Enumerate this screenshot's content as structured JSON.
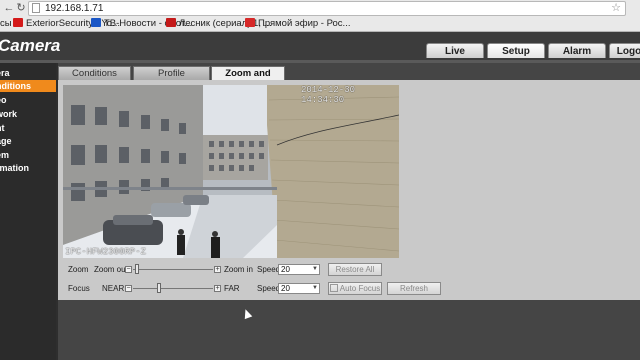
{
  "browser": {
    "url": "192.168.1.71",
    "bookmarks": [
      {
        "label": "сы",
        "color": "#cc5500"
      },
      {
        "label": "ExteriorSecurity - Yo...",
        "color": "#d41a1a"
      },
      {
        "label": "ТВ-Новости - смот...",
        "color": "#1a56c6"
      },
      {
        "label": "Лесник (сериал) 1, ...",
        "color": "#c41a1a"
      },
      {
        "label": "Прямой эфир - Рос...",
        "color": "#d62828"
      }
    ],
    "bookmark_icons": [
      "",
      "youtube-icon",
      "tv-icon",
      "kino-icon",
      "ru-icon"
    ]
  },
  "header": {
    "logo": "Camera",
    "tabs": [
      {
        "label": "Live"
      },
      {
        "label": "Setup"
      },
      {
        "label": "Alarm"
      },
      {
        "label": "Logo"
      }
    ],
    "active_tab": "Setup"
  },
  "menu": {
    "items": [
      {
        "label": "era"
      },
      {
        "label": "nditions"
      },
      {
        "label": "eo"
      },
      {
        "label": "work"
      },
      {
        "label": "nt"
      },
      {
        "label": "age"
      },
      {
        "label": "em"
      },
      {
        "label": "rmation"
      }
    ],
    "active_index": 1
  },
  "subtabs": [
    {
      "label": "Conditions"
    },
    {
      "label": "Profile Management"
    },
    {
      "label": "Zoom and Focus"
    }
  ],
  "video": {
    "timestamp": "2014-12-30 14:34:30",
    "channel": "IPC-HFW2300RP-Z"
  },
  "zoom": {
    "label": "Zoom",
    "min_label": "Zoom out",
    "max_label": "Zoom in",
    "level": 0.02,
    "speed_label": "Speed",
    "speed_value": "20",
    "restore_label": "Restore All"
  },
  "focus": {
    "label": "Focus",
    "min_label": "NEAR",
    "max_label": "FAR",
    "level": 0.32,
    "speed_label": "Speed",
    "speed_value": "20",
    "auto_label": "Auto Focus",
    "refresh_label": "Refresh"
  },
  "colors": {
    "menu_active": "#f08a1c",
    "header_bg": "#3c3c3c",
    "panel_bg": "#c9c9c9"
  }
}
